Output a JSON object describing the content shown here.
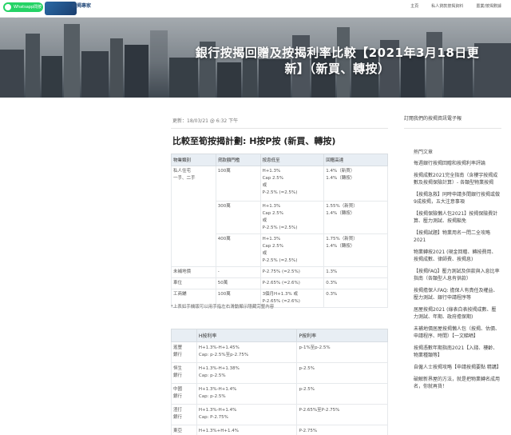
{
  "header": {
    "whatsapp_label": "Whatsapp問按揭",
    "logo_text": "",
    "brand": "按揭專家",
    "nav": [
      "主頁",
      "私人貸款按揭資料",
      "置業/按揭數據"
    ]
  },
  "hero": {
    "title": "銀行按揭回贈及按揭利率比較【2021年3月18日更新】（新買、轉按）"
  },
  "article": {
    "updated": "更新：18/03/21 @ 6:32 下午",
    "section_title": "比較至筍按揭計劃: H按P按 (新買、轉按)",
    "table1": {
      "headers": [
        "物業類別",
        "貸款額門檻",
        "按息低至",
        "回贈高達"
      ],
      "rows": [
        [
          "私人住宅\n一手、二手",
          "100萬",
          "H+1.3%\nCap 2.5%\n或\nP-2.5% (=2.5%)",
          "1.4%（新買）\n1.4%（轉按）"
        ],
        [
          "",
          "300萬",
          "H+1.3%\nCap 2.5%\n或\nP-2.5% (=2.5%)",
          "1.55%（新買）\n1.4%（轉按）"
        ],
        [
          "",
          "400萬",
          "H+1.3%\nCap 2.5%\n或\nP-2.5% (=2.5%)",
          "1.75%（新買）\n1.4%（轉按）"
        ],
        [
          "未補地價",
          "-",
          "P-2.75% (=2.5%)",
          "1.3%"
        ],
        [
          "車位",
          "50萬",
          "P-2.65% (=2.6%)",
          "0.3%"
        ],
        [
          "工商舖",
          "100萬",
          "3個月H+1.3% 或\nP-2.65% (=2.6%)",
          "0.3%"
        ]
      ]
    },
    "note": "*上表如手機版可以用手指左右滑動顯示隱藏完整內容",
    "table2": {
      "headers": [
        "",
        "H按利率",
        "P按利率"
      ],
      "rows": [
        [
          "滙豐\n銀行",
          "H+1.3%-H+1.45%\nCap: p-2.5%至p-2.75%",
          "p-1%至p-2.5%"
        ],
        [
          "恒生\n銀行",
          "H+1.3%-H+1.38%\nCap: p-2.5%",
          "p-2.5%"
        ],
        [
          "中國\n銀行",
          "H+1.3%-H+1.4%\nCap: p-2.5%",
          "p-2.5%"
        ],
        [
          "渣打\n銀行",
          "H+1.3%-H+1.4%\nCap: P-2.75%",
          "P-2.65%至P-2.75%"
        ],
        [
          "東亞\n銀行",
          "H+1.3%+H+1.4%\nCap: P-2.75%",
          "P-2.75%"
        ]
      ]
    }
  },
  "sidebar": {
    "subscribe": "訂閱我們的按揭資訊電子報",
    "popular_title": "熱門文章",
    "posts": [
      "每週銀行按揭回贈和按揭利率評論",
      "按揭成數2021完全指南（含樓宇按揭成數及按揭保險計算）- 各類型物業按揭",
      "【按揭急救】同時申請多間銀行按揭或做9成按揭，五大注意事項",
      "【按揭保險懶人包2021】按揭保險費計算、壓力測試、按揭豁免",
      "【按揭試題】物業用名一問二全攻略2021",
      "物業轉按2021 (現金回贈、轉按費用、按揭成數、律師費、按揭息)",
      "【按揭FAQ】壓力測試及供款與入息比率指南（各類型人息有供款）",
      "按揭擔保人FAQ: 擔保人有責任及權益、壓力測試、銀行申請程序等",
      "居屋按揭2021 (綠表白表按揭成數、壓力測試、年期、政府擔保期)",
      "未補地價居屋按揭懶人包（按揭、估價、申請程序、時間）【一文睇晒】",
      "按揭憑數年期指南2021【入錢、樓齡、物業種類等】",
      "自僱人士按揭攻略【申請按揭要點 精講】",
      "破解新界屋的方法，就是把物業轉名成用名，你就再貨！"
    ]
  }
}
